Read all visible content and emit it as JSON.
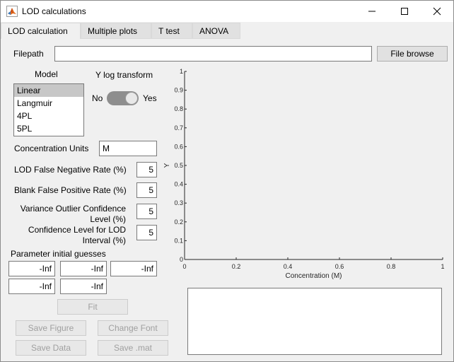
{
  "window": {
    "title": "LOD calculations"
  },
  "tabs": [
    {
      "label": "LOD calculation"
    },
    {
      "label": "Multiple plots"
    },
    {
      "label": "T test"
    },
    {
      "label": "ANOVA"
    }
  ],
  "filepath": {
    "label": "Filepath",
    "value": "",
    "browse_label": "File browse"
  },
  "model": {
    "label": "Model",
    "options": [
      "Linear",
      "Langmuir",
      "4PL",
      "5PL"
    ],
    "selected": "Linear"
  },
  "y_log_transform": {
    "label": "Y log transform",
    "off_label": "No",
    "on_label": "Yes",
    "value": "Yes"
  },
  "concentration_units": {
    "label": "Concentration Units",
    "value": "M"
  },
  "lod_false_negative": {
    "label": "LOD False Negative Rate (%)",
    "value": "5"
  },
  "blank_false_positive": {
    "label": "Blank False Positive Rate (%)",
    "value": "5"
  },
  "variance_outlier": {
    "label_line1": "Variance Outlier Confidence",
    "label_line2": "Level (%)",
    "value": "5"
  },
  "confidence_level": {
    "label_line1": "Confidence Level for LOD",
    "label_line2": "Interval (%)",
    "value": "5"
  },
  "initial_guesses": {
    "label": "Parameter initial guesses",
    "values": [
      "-Inf",
      "-Inf",
      "-Inf",
      "-Inf",
      "-Inf"
    ]
  },
  "buttons": {
    "fit": "Fit",
    "save_figure": "Save Figure",
    "change_font": "Change Font",
    "save_data": "Save Data",
    "save_mat": "Save .mat"
  },
  "chart_data": {
    "type": "line",
    "title": "",
    "xlabel": "Concentration (M)",
    "ylabel": "Y",
    "xlim": [
      0,
      1
    ],
    "ylim": [
      0,
      1
    ],
    "xticks": [
      "0",
      "0.2",
      "0.4",
      "0.6",
      "0.8",
      "1"
    ],
    "yticks": [
      "0",
      "0.1",
      "0.2",
      "0.3",
      "0.4",
      "0.5",
      "0.6",
      "0.7",
      "0.8",
      "0.9",
      "1"
    ],
    "series": [],
    "grid": false
  },
  "output_text": ""
}
